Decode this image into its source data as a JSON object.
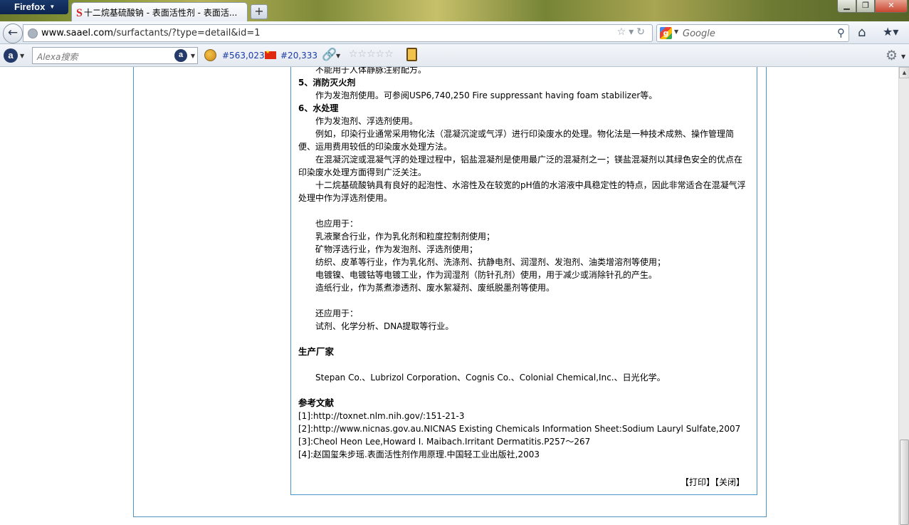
{
  "browser": {
    "menu_label": "Firefox",
    "tab_title": "十二烷基硫酸钠 - 表面活性剂 - 表面活...",
    "new_tab": "+",
    "url_host": "www.saael.com",
    "url_path": "/surfactants/?type=detail&id=1",
    "search_placeholder": "Google"
  },
  "alexa": {
    "search_placeholder": "Alexa搜索",
    "global_rank": "#563,023",
    "china_rank": "#20,333",
    "stars": "☆☆☆☆☆"
  },
  "content": {
    "line_0": "不能用于人体静脉注射配方。",
    "h5": "5、消防灭火剂",
    "p5": "作为发泡剂使用。可参阅USP6,740,250 Fire suppressant having foam stabilizer等。",
    "h6": "6、水处理",
    "p6a": "作为发泡剂、浮选剂使用。",
    "p6b_1": "例如，印染行业通常采用物化法（混凝沉淀或气浮）进行印染废水的处理。物化法是一种技术成熟、操作管理简",
    "p6b_2": "便、运用费用较低的印染废水处理方法。",
    "p6c_1": "在混凝沉淀或混凝气浮的处理过程中，铝盐混凝剂是使用最广泛的混凝剂之一；镁盐混凝剂以其绿色安全的优点在",
    "p6c_2": "印染废水处理方面得到广泛关注。",
    "p6d_1": "十二烷基硫酸钠具有良好的起泡性、水溶性及在较宽的pH值的水溶液中具稳定性的特点，因此非常适合在混凝气浮",
    "p6d_2": "处理中作为浮选剂使用。",
    "also_title": "也应用于：",
    "also_items": [
      "乳液聚合行业，作为乳化剂和粒度控制剂使用；",
      "矿物浮选行业，作为发泡剂、浮选剂使用；",
      "纺织、皮革等行业，作为乳化剂、洗涤剂、抗静电剂、润湿剂、发泡剂、油类增溶剂等使用；",
      "电镀镍、电镀钴等电镀工业，作为润湿剂（防针孔剂）使用，用于减少或消除针孔的产生。",
      "造纸行业，作为蒸煮渗透剂、废水絮凝剂、废纸脱墨剂等使用。"
    ],
    "still_title": "还应用于：",
    "still_text": "试剂、化学分析、DNA提取等行业。",
    "maker_title": "生产厂家",
    "maker_text": "Stepan Co.、Lubrizol Corporation、Cognis Co.、Colonial Chemical,Inc.、日光化学。",
    "ref_title": "参考文献",
    "refs": [
      "[1]:http://toxnet.nlm.nih.gov/:151-21-3",
      "[2]:http://www.nicnas.gov.au.NICNAS Existing Chemicals Information Sheet:Sodium Lauryl Sulfate,2007",
      "[3]:Cheol Heon Lee,Howard I. Maibach.Irritant Dermatitis.P257～267",
      "[4]:赵国玺朱步瑶.表面活性剂作用原理.中国轻工业出版社,2003"
    ],
    "print_label": "【打印】",
    "close_label": "【关闭】"
  }
}
